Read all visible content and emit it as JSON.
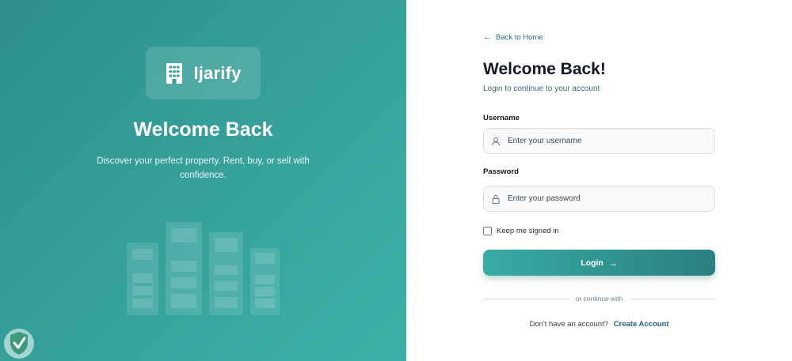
{
  "brand": {
    "name": "Ijarify",
    "logo_icon": "building-icon"
  },
  "hero": {
    "title": "Welcome Back",
    "subtitle": "Discover your perfect property. Rent, buy, or sell with confidence."
  },
  "form": {
    "back_label": "Back to Home",
    "title": "Welcome Back!",
    "subtitle": "Login to continue to your account",
    "username_label": "Username",
    "username_placeholder": "Enter your username",
    "password_label": "Password",
    "password_placeholder": "Enter your password",
    "remember_label": "Keep me signed in",
    "login_label": "Login",
    "divider_text": "or continue with",
    "signup_prompt": "Don't have an account?",
    "signup_link": "Create Account"
  },
  "colors": {
    "accent": "#36a29c",
    "accent_dark": "#2a7f80",
    "link": "#1e5e7a"
  }
}
